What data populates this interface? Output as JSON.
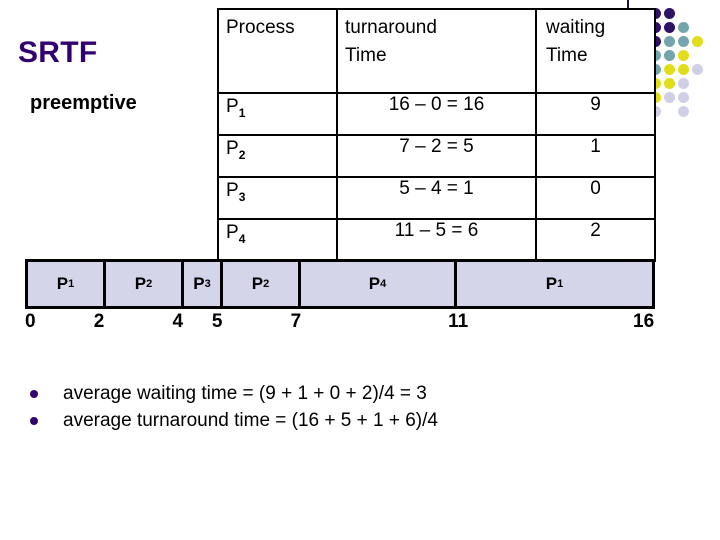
{
  "title": {
    "main": "SRTF",
    "main_color": "#33006f",
    "subtitle": "preemptive"
  },
  "table": {
    "headers": {
      "process": "Process",
      "turnaround_line1": "turnaround",
      "turnaround_line2": "Time",
      "waiting_line1": "waiting",
      "waiting_line2": "Time"
    },
    "rows": [
      {
        "process": "P",
        "process_sub": "1",
        "turnaround": "16 – 0 = 16",
        "waiting": "9"
      },
      {
        "process": "P",
        "process_sub": "2",
        "turnaround": "7 – 2 = 5",
        "waiting": "1"
      },
      {
        "process": "P",
        "process_sub": "3",
        "turnaround": "5 – 4 = 1",
        "waiting": "0"
      },
      {
        "process": "P",
        "process_sub": "4",
        "turnaround": "11 – 5 = 6",
        "waiting": "2"
      }
    ]
  },
  "gantt": {
    "fill_color": "#d5d5ea",
    "border_color": "#000000",
    "segments": [
      {
        "label": "P",
        "sub": "1",
        "start": 0,
        "end": 2
      },
      {
        "label": "P",
        "sub": "2",
        "start": 2,
        "end": 4
      },
      {
        "label": "P",
        "sub": "3",
        "start": 4,
        "end": 5
      },
      {
        "label": "P",
        "sub": "2",
        "start": 5,
        "end": 7
      },
      {
        "label": "P",
        "sub": "4",
        "start": 7,
        "end": 11
      },
      {
        "label": "P",
        "sub": "1",
        "start": 11,
        "end": 16
      }
    ],
    "ticks": [
      "0",
      "2",
      "4",
      "5",
      "7",
      "11",
      "16"
    ],
    "tick_values": [
      0,
      2,
      4,
      5,
      7,
      11,
      16
    ],
    "axis_start": 0,
    "axis_end": 16
  },
  "bullets": [
    "average waiting time = (9 + 1 + 0 + 2)/4 = 3",
    "average turnaround time = (16 + 5 + 1 + 6)/4"
  ],
  "decoration": {
    "palette": {
      "purple": "#2e1266",
      "teal": "#72a6ac",
      "yellow": "#e2dd1b",
      "pale": "#cfd0e6"
    },
    "grid": [
      [
        "purple",
        "purple",
        "purple",
        null,
        null,
        null
      ],
      [
        "purple",
        "purple",
        "purple",
        "teal",
        null,
        null
      ],
      [
        "purple",
        "purple",
        "teal",
        "teal",
        "yellow",
        null
      ],
      [
        "purple",
        "teal",
        "teal",
        "yellow",
        null,
        null
      ],
      [
        "teal",
        "teal",
        "yellow",
        "yellow",
        "pale",
        null
      ],
      [
        "teal",
        "yellow",
        "yellow",
        "pale",
        null,
        null
      ],
      [
        "yellow",
        "yellow",
        "pale",
        "pale",
        null,
        null
      ],
      [
        null,
        "pale",
        null,
        "pale",
        null,
        null
      ]
    ]
  }
}
